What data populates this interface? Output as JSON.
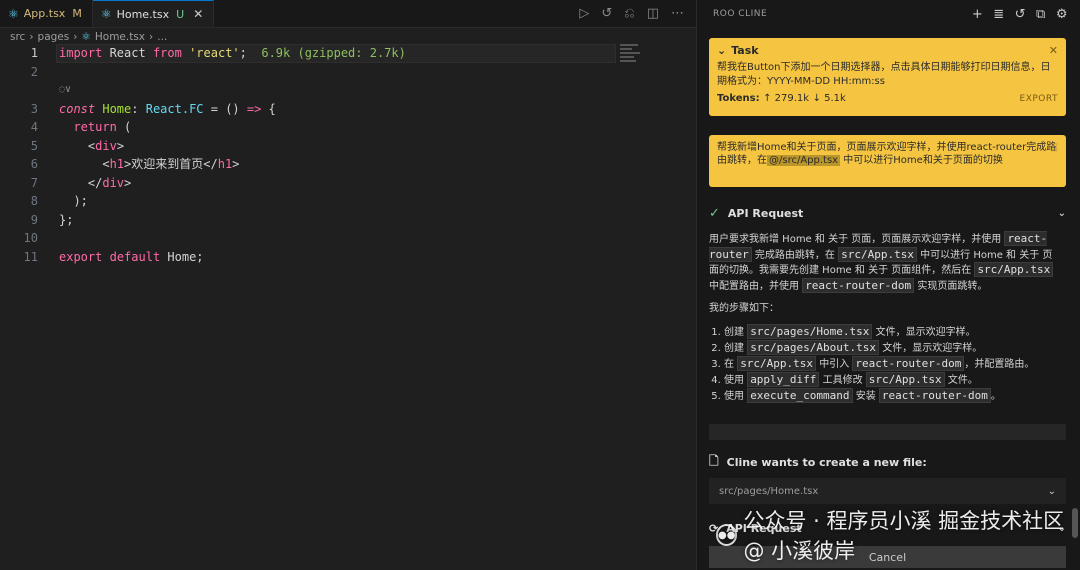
{
  "editor": {
    "tabs": [
      {
        "label": "App.tsx",
        "mark": "M"
      },
      {
        "label": "Home.tsx",
        "mark": "U",
        "close": "✕"
      }
    ],
    "breadcrumb": [
      "src",
      "pages",
      "Home.tsx",
      "..."
    ],
    "lines": [
      {
        "n": "1"
      },
      {
        "n": "2"
      },
      {
        "n": "3"
      },
      {
        "n": "4"
      },
      {
        "n": "5"
      },
      {
        "n": "6"
      },
      {
        "n": "7"
      },
      {
        "n": "8"
      },
      {
        "n": "9"
      },
      {
        "n": "10"
      },
      {
        "n": "11"
      }
    ],
    "import_size": "6.9k (gzipped: 2.7k)"
  },
  "panel": {
    "title": "ROO CLINE",
    "task": {
      "label": "Task",
      "body": "帮我在Button下添加一个日期选择器，点击具体日期能够打印日期信息，日期格式为：YYYY-MM-DD HH:mm:ss",
      "tokens_label": "Tokens:",
      "tokens_up": "↑ 279.1k",
      "tokens_down": "↓ 5.1k",
      "export": "EXPORT"
    },
    "message": {
      "pre": "帮我新增Home和关于页面，页面展示欢迎字样，并使用react-router完成路由跳转，在",
      "path": "@/src/App.tsx",
      "post": " 中可以进行Home和关于页面的切换"
    },
    "api_request": "API Request",
    "reply": {
      "p1_a": "用户要求我新增 Home 和 关于 页面，页面展示欢迎字样，并使用 ",
      "p1_code1": "react-router",
      "p1_b": " 完成路由跳转，在 ",
      "p1_code2": "src/App.tsx",
      "p1_c": " 中可以进行 Home 和 关于 页面的切换。我需要先创建 Home 和 关于 页面组件，然后在 ",
      "p1_code3": "src/App.tsx",
      "p1_d": " 中配置路由，并使用 ",
      "p1_code4": "react-router-dom",
      "p1_e": " 实现页面跳转。",
      "p2": "我的步骤如下：",
      "steps": [
        {
          "a": "创建 ",
          "code": "src/pages/Home.tsx",
          "b": " 文件，显示欢迎字样。"
        },
        {
          "a": "创建 ",
          "code": "src/pages/About.tsx",
          "b": " 文件，显示欢迎字样。"
        },
        {
          "a": "在 ",
          "code": "src/App.tsx",
          "b": " 中引入 ",
          "code2": "react-router-dom",
          "c": "，并配置路由。"
        },
        {
          "a": "使用 ",
          "code": "apply_diff",
          "b": " 工具修改 ",
          "code2": "src/App.tsx",
          "c": " 文件。"
        },
        {
          "a": "使用 ",
          "code": "execute_command",
          "b": " 安装 ",
          "code2": "react-router-dom",
          "c": "。"
        }
      ]
    },
    "create_file": "Cline wants to create a new file:",
    "file_path": "src/pages/Home.tsx",
    "api_request2": "API Request",
    "cancel": "Cancel"
  },
  "watermark": "公众号 · 程序员小溪  掘金技术社区 @ 小溪彼岸"
}
